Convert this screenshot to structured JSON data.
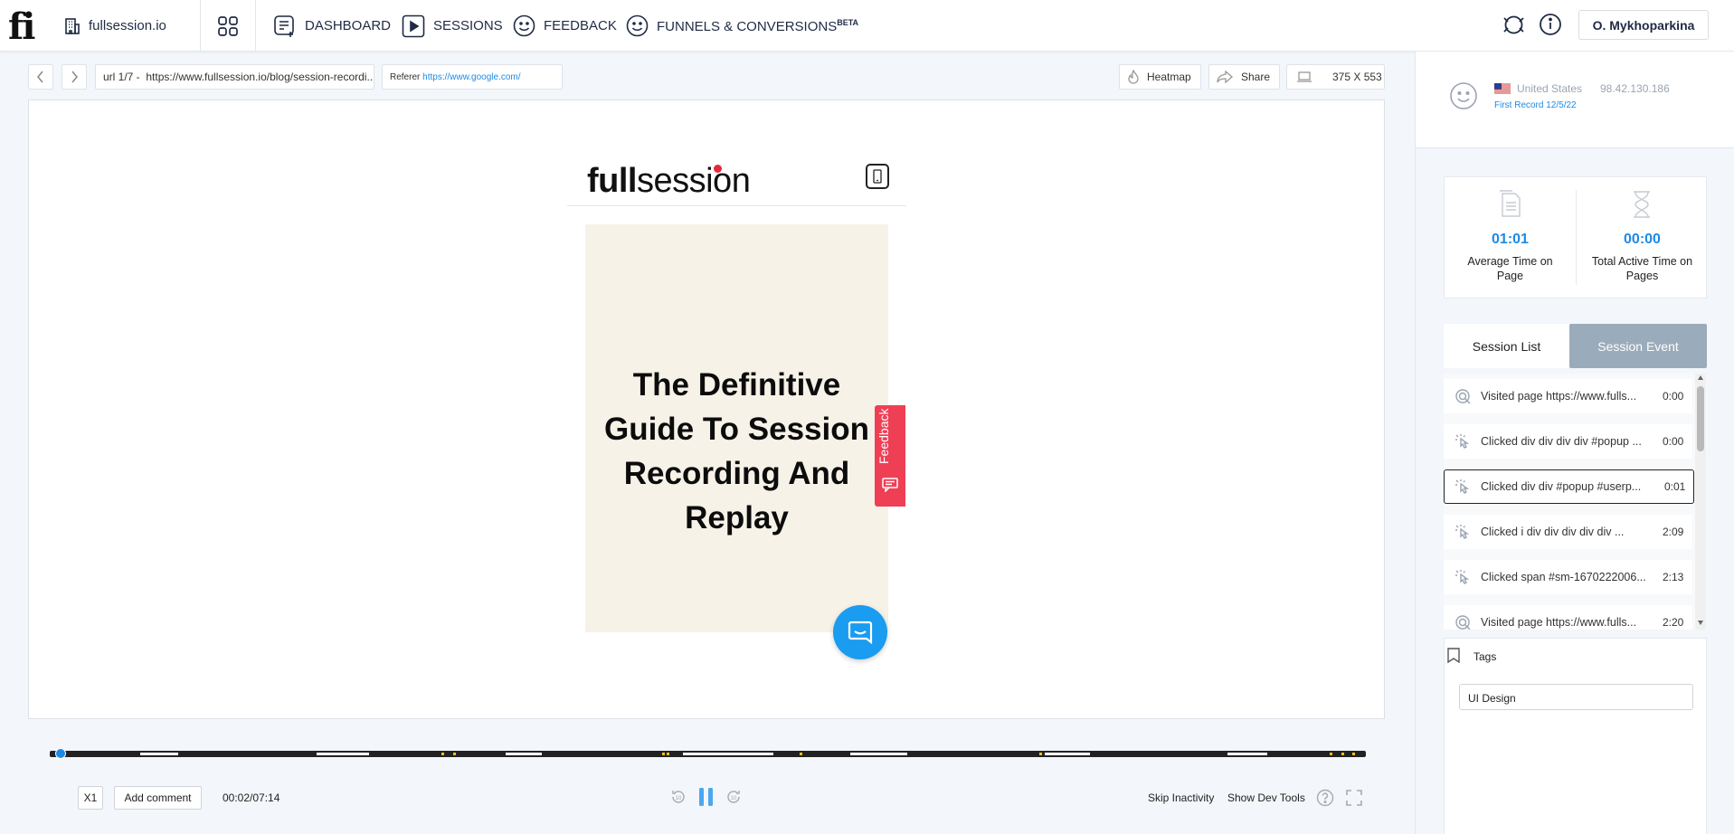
{
  "nav": {
    "logo": "fi",
    "org_name": "fullsession.io",
    "items": [
      {
        "label": "DASHBOARD"
      },
      {
        "label": "SESSIONS"
      },
      {
        "label": "FEEDBACK"
      },
      {
        "label": "FUNNELS & CONVERSIONS",
        "badge": "BETA"
      }
    ],
    "user": "O. Mykhoparkina"
  },
  "toolbar": {
    "url_label": "url 1/7 -",
    "url_value": "https://www.fullsession.io/blog/session-recordi...",
    "referer_label": "Referer",
    "referer_value": "https://www.google.com/",
    "heatmap": "Heatmap",
    "share": "Share",
    "viewport": "375 X 553"
  },
  "replay": {
    "brand_bold": "full",
    "brand_rest": "session",
    "hero_title": "The Definitive Guide To Session Recording And Replay",
    "feedback_tab": "Feedback"
  },
  "controls": {
    "speed": "X1",
    "add_comment": "Add comment",
    "time": "00:02/07:14",
    "skip_back": "10",
    "skip_fwd": "10",
    "skip_inactivity": "Skip Inactivity",
    "dev_tools": "Show Dev Tools",
    "progress": 0.005
  },
  "visitor": {
    "country": "United States",
    "ip": "98.42.130.186",
    "first_record": "First Record 12/5/22"
  },
  "stats": {
    "avg_time_value": "01:01",
    "avg_time_label": "Average Time on Page",
    "active_time_value": "00:00",
    "active_time_label": "Total Active Time on Pages"
  },
  "tabs": {
    "list": "Session List",
    "event": "Session Event"
  },
  "events": [
    {
      "type": "visit",
      "text": "Visited page https://www.fulls...",
      "time": "0:00"
    },
    {
      "type": "click",
      "text": "Clicked div div div div #popup ...",
      "time": "0:00"
    },
    {
      "type": "click",
      "text": "Clicked div div #popup #userp...",
      "time": "0:01"
    },
    {
      "type": "click",
      "text": "Clicked i div div div div div ...",
      "time": "2:09"
    },
    {
      "type": "click",
      "text": "Clicked span #sm-1670222006...",
      "time": "2:13"
    },
    {
      "type": "visit",
      "text": "Visited page https://www.fulls...",
      "time": "2:20"
    }
  ],
  "tags": {
    "title": "Tags",
    "value": "UI Design"
  },
  "colors": {
    "accent": "#1d8ae6",
    "tab_active_bg": "#9aabbb",
    "feedback_red": "#ef3f55",
    "chat_blue": "#1a9cf0",
    "hero_bg": "#f6f2e8"
  }
}
